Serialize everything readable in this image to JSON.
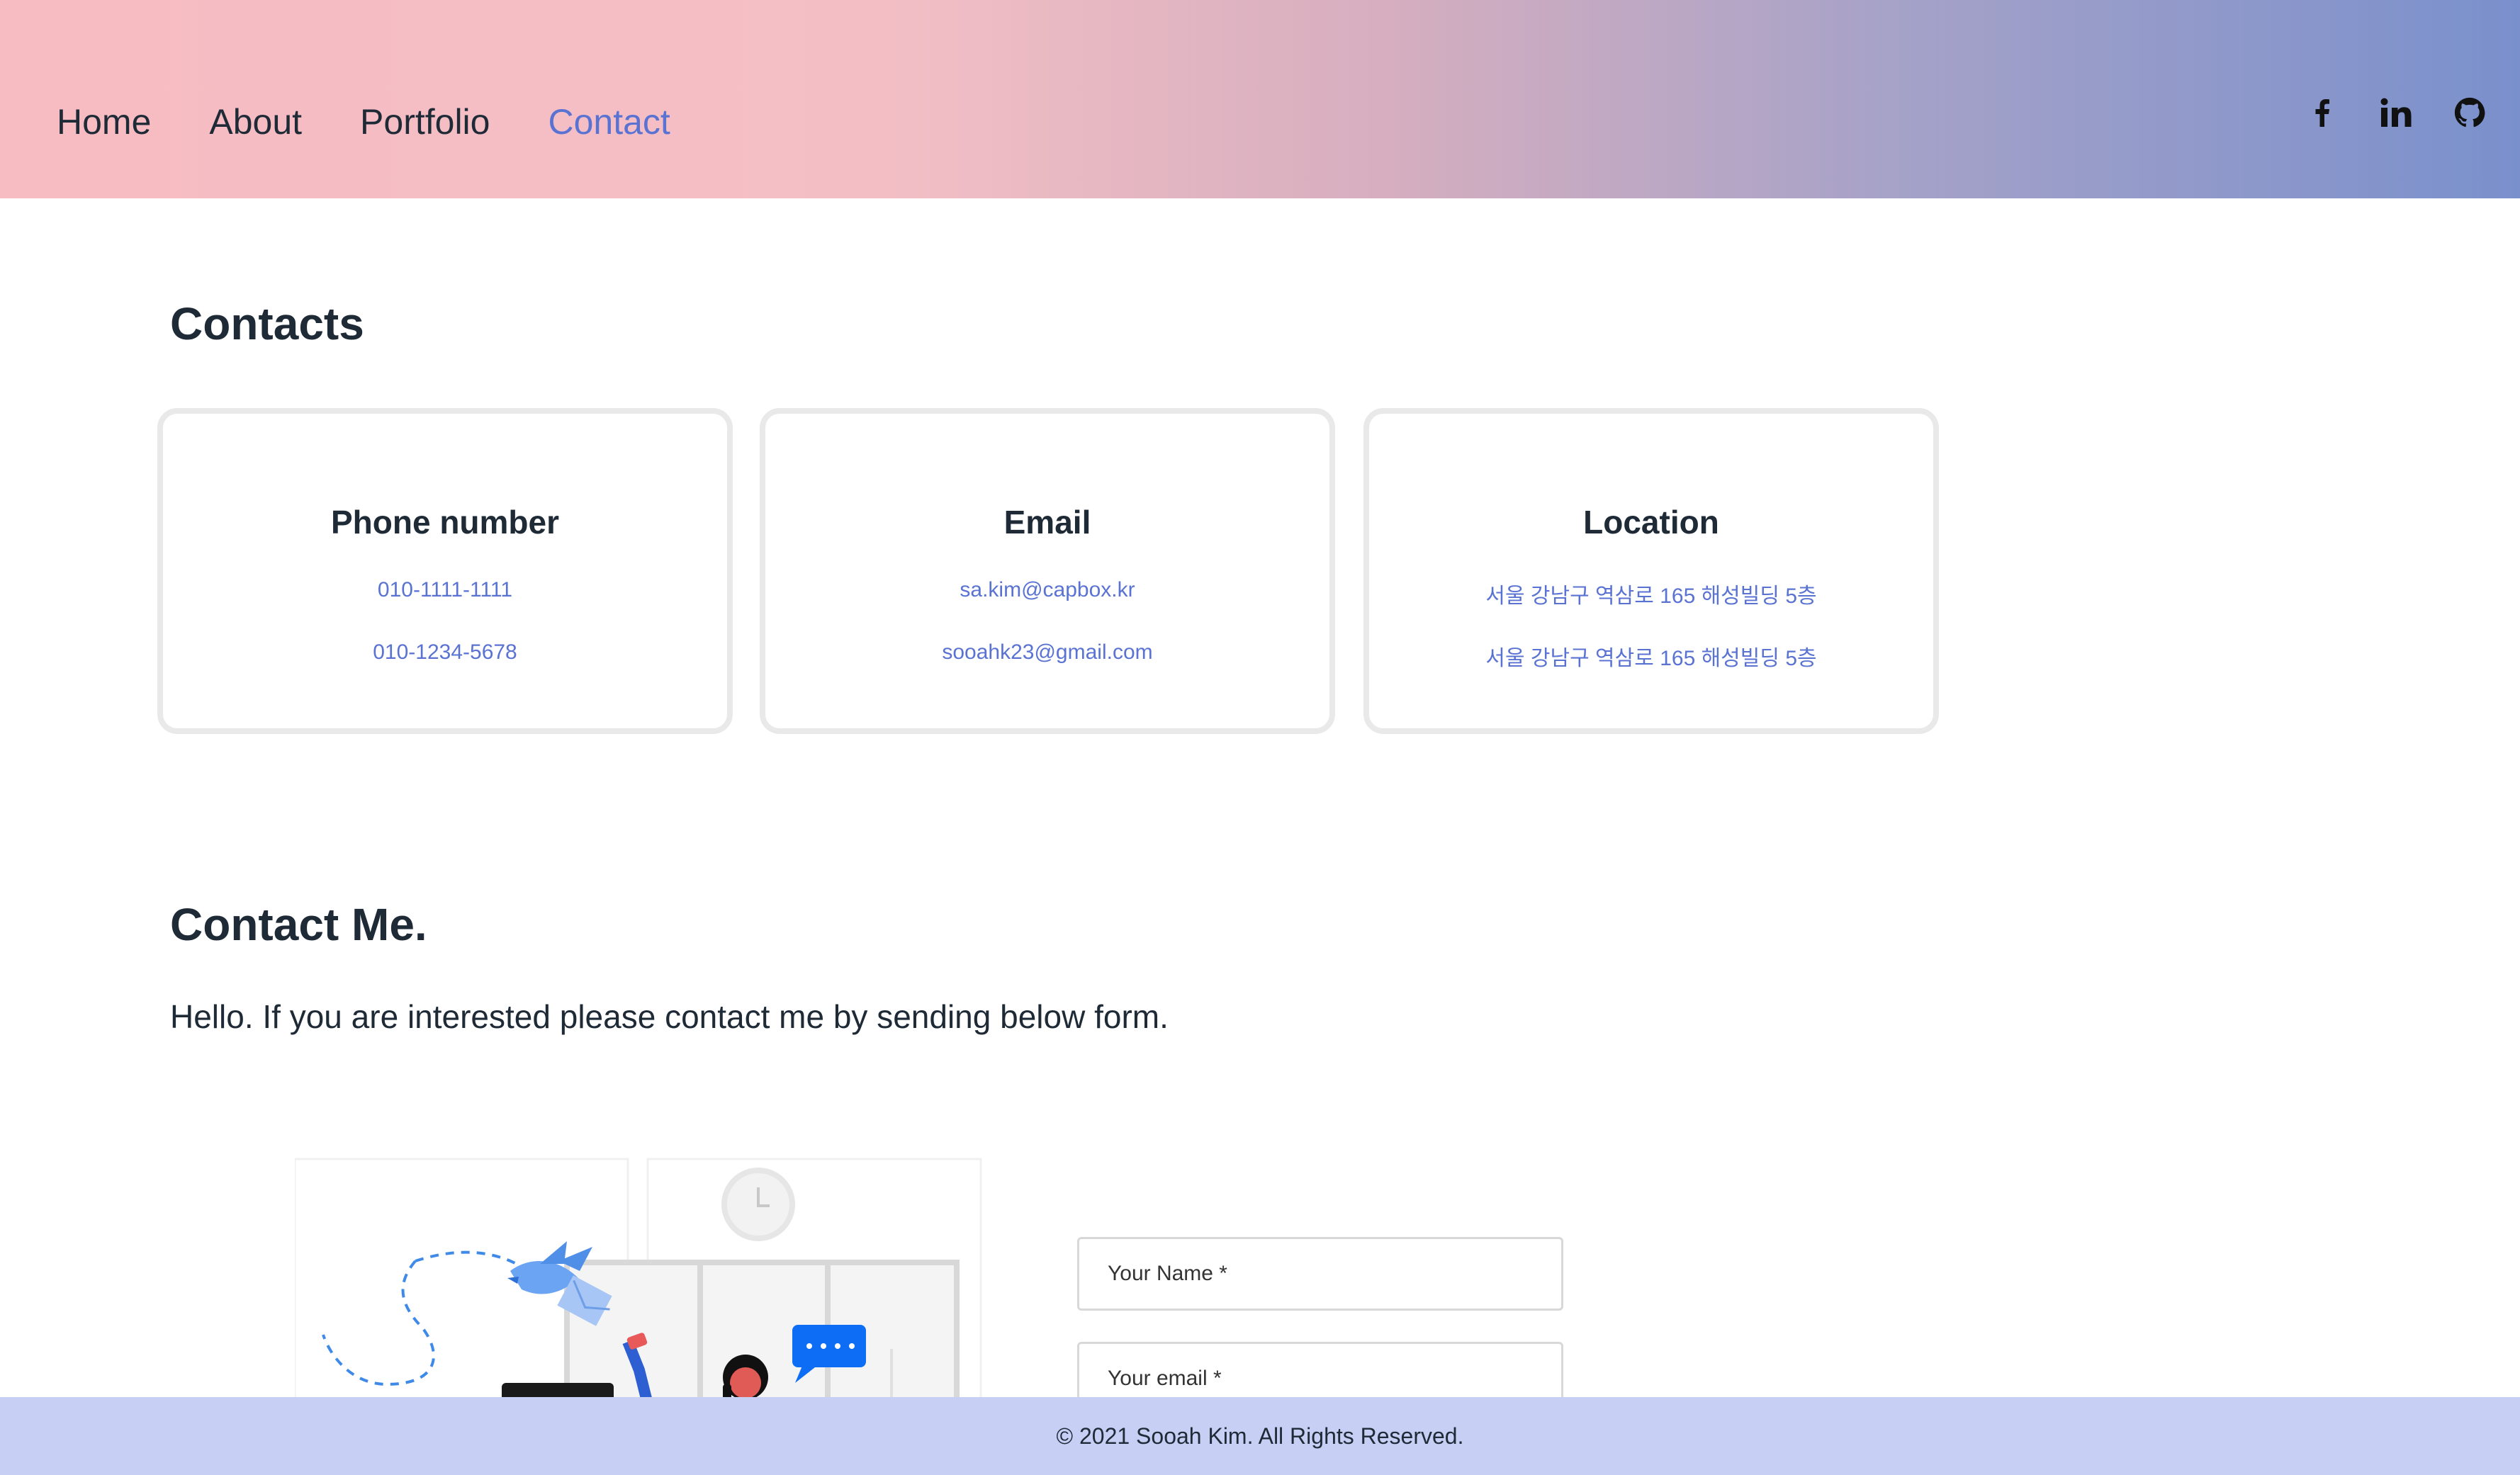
{
  "nav": {
    "items": [
      {
        "label": "Home",
        "active": false
      },
      {
        "label": "About",
        "active": false
      },
      {
        "label": "Portfolio",
        "active": false
      },
      {
        "label": "Contact",
        "active": true
      }
    ],
    "social": [
      "facebook-icon",
      "linkedin-icon",
      "github-icon"
    ]
  },
  "contacts": {
    "title": "Contacts",
    "cards": [
      {
        "title": "Phone number",
        "lines": [
          "010-1111-1111",
          "010-1234-5678"
        ]
      },
      {
        "title": "Email",
        "lines": [
          "sa.kim@capbox.kr",
          "sooahk23@gmail.com"
        ]
      },
      {
        "title": "Location",
        "lines": [
          "서울 강남구 역삼로 165 해성빌딩 5층",
          "서울 강남구 역삼로 165 해성빌딩 5층"
        ]
      }
    ]
  },
  "contact_me": {
    "title": "Contact Me.",
    "intro": "Hello. If you are interested please contact me by sending below form."
  },
  "form": {
    "name_placeholder": "Your Name *",
    "email_placeholder": "Your email *"
  },
  "footer": {
    "text": "© 2021 Sooah Kim. All Rights Reserved."
  },
  "colors": {
    "accent": "#5a73d3",
    "footer_bg": "#c7cff5",
    "header_start": "#f6bcc2",
    "header_end": "#7a90cc"
  }
}
